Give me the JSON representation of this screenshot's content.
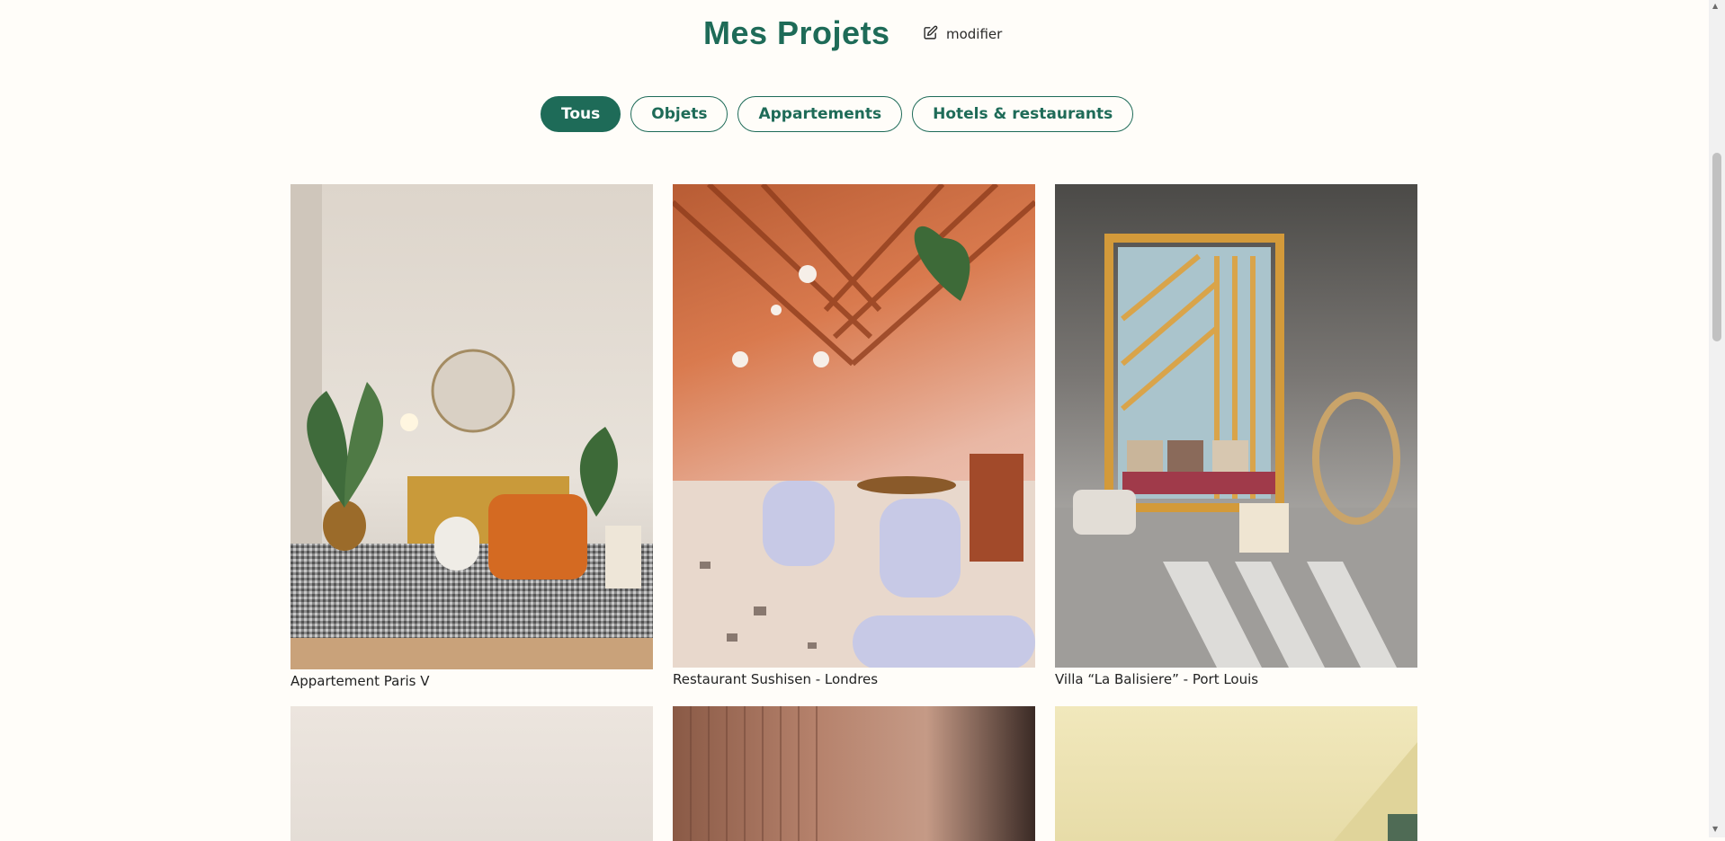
{
  "header": {
    "title": "Mes Projets",
    "edit_label": "modifier"
  },
  "filters": [
    {
      "label": "Tous",
      "active": true
    },
    {
      "label": "Objets",
      "active": false
    },
    {
      "label": "Appartements",
      "active": false
    },
    {
      "label": "Hotels & restaurants",
      "active": false
    }
  ],
  "projects": [
    {
      "caption": "Appartement Paris V"
    },
    {
      "caption": "Restaurant Sushisen - Londres"
    },
    {
      "caption": "Villa “La Balisiere” - Port Louis"
    }
  ],
  "colors": {
    "accent": "#1e6b58",
    "background": "#fffdf9"
  }
}
